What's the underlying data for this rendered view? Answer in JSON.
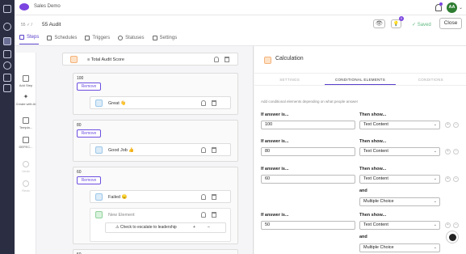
{
  "app": {
    "brand": "Sales Demo",
    "avatar_initials": "AA",
    "accent_color": "#5a3ec8"
  },
  "header": {
    "crumb": "55 ✓ /",
    "title": "55 Audit",
    "tabs": [
      {
        "label": "Steps",
        "icon": "list-icon",
        "active": true
      },
      {
        "label": "Schedules",
        "icon": "calendar-icon"
      },
      {
        "label": "Triggers",
        "icon": "swap-icon"
      },
      {
        "label": "Statuses",
        "icon": "check-circle-icon"
      },
      {
        "label": "Settings",
        "icon": "sliders-icon"
      }
    ],
    "badge_count": "0",
    "saved_label": "Saved",
    "close_label": "Close"
  },
  "tools": [
    {
      "label": "Add Step",
      "icon": "add-step-icon"
    },
    {
      "label": "Create with AI",
      "icon": "sparkle-icon"
    },
    {
      "label": "Templa...",
      "icon": "template-icon"
    },
    {
      "label": "DEFEC...",
      "icon": "defect-icon"
    },
    {
      "label": "Undo",
      "icon": "undo-icon"
    },
    {
      "label": "Redo",
      "icon": "redo-icon"
    }
  ],
  "canvas": {
    "root_title": "Total Audit Score",
    "remove_label": "Remove",
    "conditions": [
      {
        "value": "100",
        "child": "Great 👋"
      },
      {
        "value": "80",
        "child": "Good Job 👍"
      },
      {
        "value": "60",
        "child": "Failed 😞",
        "new_element": "New Element",
        "escalate": "⚠ Check to escalate to leadership"
      },
      {
        "value": "50"
      }
    ]
  },
  "panel": {
    "title": "Calculation",
    "tabs": [
      "SETTINGS",
      "CONDITIONAL ELEMENTS",
      "CONDITIONS"
    ],
    "active_tab": 1,
    "hint": "Add conditional elements depending on what people answer",
    "if_label": "If answer is...",
    "then_label": "Then show...",
    "and_label": "and",
    "rules": [
      {
        "value": "100",
        "shows": [
          "Text Content"
        ]
      },
      {
        "value": "80",
        "shows": [
          "Text Content"
        ]
      },
      {
        "value": "60",
        "shows": [
          "Text Content",
          "Multiple Choice"
        ]
      },
      {
        "value": "50",
        "shows": [
          "Text Content",
          "Multiple Choice"
        ]
      }
    ]
  }
}
